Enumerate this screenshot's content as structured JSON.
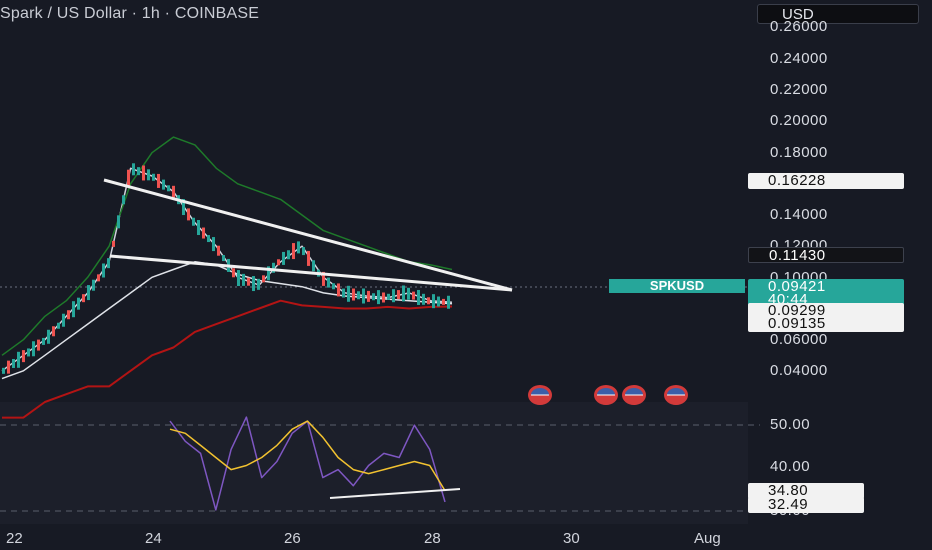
{
  "header": {
    "title": "Spark / US Dollar · 1h · COINBASE",
    "currency": "USD"
  },
  "price_axis": {
    "ticks": [
      "0.26000",
      "0.24000",
      "0.22000",
      "0.20000",
      "0.18000",
      "0.14000",
      "0.12000",
      "0.10000",
      "0.06000",
      "0.04000"
    ],
    "markers": {
      "upper_band": "0.16228",
      "mid_band": "0.11430",
      "symbol": "SPKUSD",
      "last_price": "0.09421",
      "countdown": "40:44",
      "lower_a": "0.09299",
      "lower_b": "0.09135"
    }
  },
  "rsi_axis": {
    "ticks": [
      "50.00",
      "40.00",
      "30.00"
    ],
    "markers": {
      "rsi_ma": "34.80",
      "rsi": "32.49"
    }
  },
  "time_axis": {
    "labels": [
      "22",
      "24",
      "26",
      "28",
      "30",
      "Aug"
    ]
  },
  "events": {
    "flag_icon_count": 4
  },
  "chart_data": {
    "type": "line",
    "title": "Spark / US Dollar · 1h · COINBASE",
    "price_ylim": [
      0.03,
      0.27
    ],
    "rsi_ylim": [
      28,
      56
    ],
    "x": [
      "22",
      "24",
      "26",
      "28",
      "30",
      "Aug"
    ],
    "series": [
      {
        "values": [
          0.05,
          0.06,
          0.07,
          0.085,
          0.1,
          0.12,
          0.18,
          0.175,
          0.165,
          0.145,
          0.13,
          0.11,
          0.105,
          0.12,
          0.13,
          0.11,
          0.1,
          0.098,
          0.097,
          0.1,
          0.095,
          0.094
        ]
      },
      {
        "values": [
          0.06,
          0.07,
          0.085,
          0.095,
          0.11,
          0.13,
          0.17,
          0.19,
          0.2,
          0.195,
          0.18,
          0.17,
          0.165,
          0.16,
          0.15,
          0.14,
          0.135,
          0.13,
          0.125,
          0.12,
          0.118,
          0.115
        ]
      },
      {
        "values": [
          0.045,
          0.05,
          0.06,
          0.07,
          0.08,
          0.09,
          0.1,
          0.11,
          0.115,
          0.12,
          0.118,
          0.112,
          0.108,
          0.106,
          0.104,
          0.1,
          0.098,
          0.097,
          0.096,
          0.095,
          0.094,
          0.093
        ]
      },
      {
        "values": [
          0.02,
          0.02,
          0.03,
          0.035,
          0.04,
          0.04,
          0.05,
          0.06,
          0.065,
          0.075,
          0.08,
          0.085,
          0.09,
          0.095,
          0.092,
          0.091,
          0.09,
          0.09,
          0.091,
          0.09,
          0.091,
          0.0913
        ]
      },
      {
        "values": [
          52,
          47,
          44,
          30,
          45,
          53,
          38,
          42,
          49,
          52,
          38,
          40,
          36,
          41,
          44,
          43,
          51,
          45,
          32
        ]
      },
      {
        "values": [
          50,
          49,
          46,
          43,
          40,
          41,
          43,
          46,
          50,
          52,
          48,
          43,
          40,
          39,
          40,
          41,
          42,
          41,
          34.8
        ]
      }
    ]
  }
}
